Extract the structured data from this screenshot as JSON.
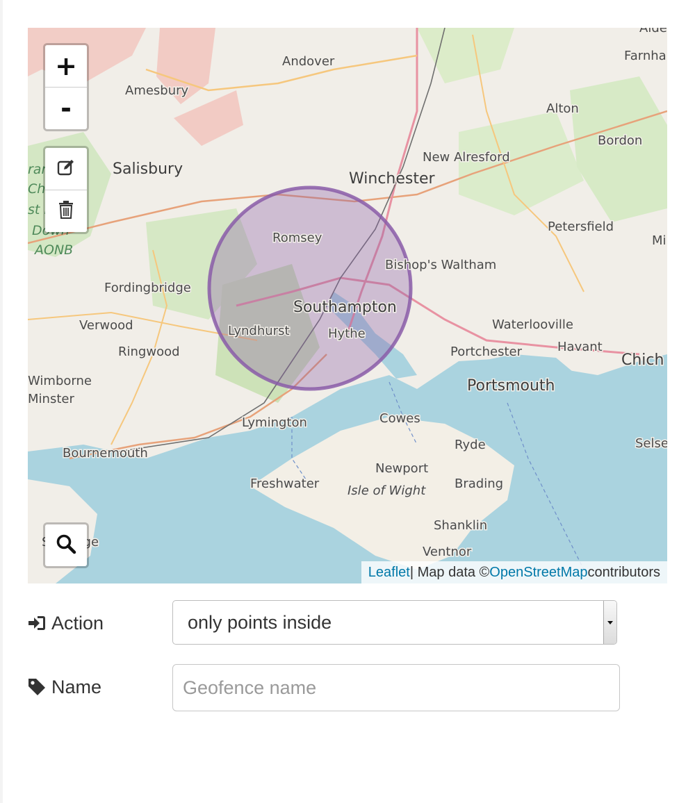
{
  "map": {
    "zoom_in_label": "+",
    "zoom_out_label": "-",
    "places": {
      "andover": "Andover",
      "amesbury": "Amesbury",
      "salisbury": "Salisbury",
      "winchester": "Winchester",
      "new_alresford": "New Alresford",
      "alton": "Alton",
      "bordon": "Bordon",
      "farnham": "Farnha",
      "alde": "Alde",
      "petersfield": "Petersfield",
      "mi": "Mi",
      "romsey": "Romsey",
      "bishops_waltham": "Bishop's Waltham",
      "southampton": "Southampton",
      "fordingbridge": "Fordingbridge",
      "verwood": "Verwood",
      "ringwood": "Ringwood",
      "lyndhurst": "Lyndhurst",
      "hythe": "Hythe",
      "waterlooville": "Waterlooville",
      "havant": "Havant",
      "chich": "Chich",
      "portchester": "Portchester",
      "portsmouth": "Portsmouth",
      "wimborne": "Wimborne",
      "minster": "Minster",
      "lymington": "Lymington",
      "cowes": "Cowes",
      "ryde": "Ryde",
      "selse": "Selse",
      "bournemouth": "Bournemouth",
      "newport": "Newport",
      "freshwater": "Freshwater",
      "isle_of_wight": "Isle of Wight",
      "brading": "Brading",
      "shanklin": "Shanklin",
      "ventnor": "Ventnor",
      "swanage": "Swanage",
      "aonb_1": "ranbo",
      "aonb_2": "Ch",
      "aonb_3": "st  bhire",
      "aonb_4": "Down",
      "aonb_5": "AONB"
    },
    "geofence_color": "#8a5ca8",
    "attribution": {
      "leaflet": "Leaflet",
      "sep": " | Map data © ",
      "osm": "OpenStreetMap",
      "contributors": " contributors"
    }
  },
  "form": {
    "action_label": "Action",
    "action_value": "only points inside",
    "name_label": "Name",
    "name_placeholder": "Geofence name",
    "name_value": ""
  }
}
